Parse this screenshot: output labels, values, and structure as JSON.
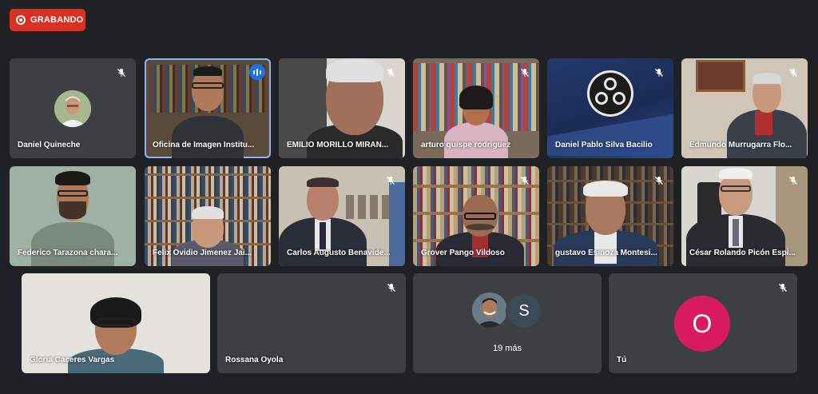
{
  "recording": {
    "label": "GRABANDO"
  },
  "participants": [
    {
      "name": "Daniel Quineche"
    },
    {
      "name": "Oficina de Imagen Institu..."
    },
    {
      "name": "EMILIO MORILLO MIRAN..."
    },
    {
      "name": "arturo quispe rodriguez"
    },
    {
      "name": "Daniel Pablo Silva Bacilio"
    },
    {
      "name": "Edmundo Murrugarra Flo..."
    },
    {
      "name": "Federico Tarazona chara..."
    },
    {
      "name": "Felix Ovidio Jimenez Jai..."
    },
    {
      "name": "Carlos Augusto Benavide..."
    },
    {
      "name": "Grover Pango Vildoso"
    },
    {
      "name": "gustavo Esinoza Montesi..."
    },
    {
      "name": "César Rolando Picón Espi..."
    },
    {
      "name": "Gloria Caceres Vargas"
    },
    {
      "name": "Rossana Oyola"
    }
  ],
  "overflow": {
    "avatar_letter": "S",
    "count_label": "19 más"
  },
  "self": {
    "avatar_letter": "O",
    "name": "Tú"
  },
  "colors": {
    "background": "#202124",
    "tile": "#3c4043",
    "recording": "#d93025",
    "speaking": "#1a73e8",
    "self_avatar": "#d81b60",
    "overflow_avatar": "#5f6368"
  },
  "icons": {
    "mic_off": "mic-off-icon",
    "recording": "record-icon",
    "speaking": "audio-wave-icon",
    "obs": "obs-logo-icon"
  }
}
